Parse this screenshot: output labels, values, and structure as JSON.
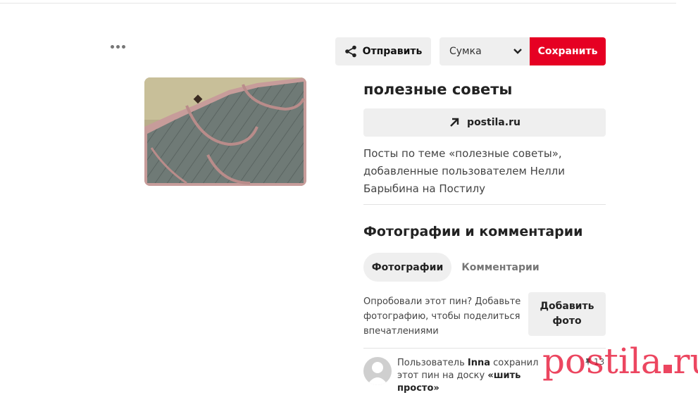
{
  "toolbar": {
    "share_label": "Отправить",
    "board_selected": "Сумка",
    "save_label": "Сохранить"
  },
  "pin": {
    "title": "полезные советы",
    "source_label": "postila.ru",
    "description": "Посты по теме «полезные советы», добавленные пользователем Нелли Барыбина на Постилу"
  },
  "photos_section": {
    "title": "Фотографии и комментарии",
    "tabs": [
      {
        "label": "Фотографии",
        "active": true
      },
      {
        "label": "Комментарии",
        "active": false
      }
    ],
    "prompt_text": "Опробовали этот пин? Добавьте фотографию, чтобы поделиться впечатлениями",
    "add_photo_label": "Добавить фото"
  },
  "activity": {
    "prefix": "Пользователь",
    "user": "Inna",
    "action": "сохранил этот пин на доску",
    "board": "«шить просто»",
    "repin_count": "13"
  },
  "watermark": {
    "left": "postila",
    "right": "ru"
  },
  "colors": {
    "accent": "#e60023",
    "button_bg": "#efefef"
  },
  "icons": {
    "more": "ellipsis-icon",
    "share": "share-icon",
    "chevron": "chevron-down-icon",
    "source": "arrow-up-right-icon",
    "expand": "expand-icon",
    "pin": "pushpin-icon"
  }
}
